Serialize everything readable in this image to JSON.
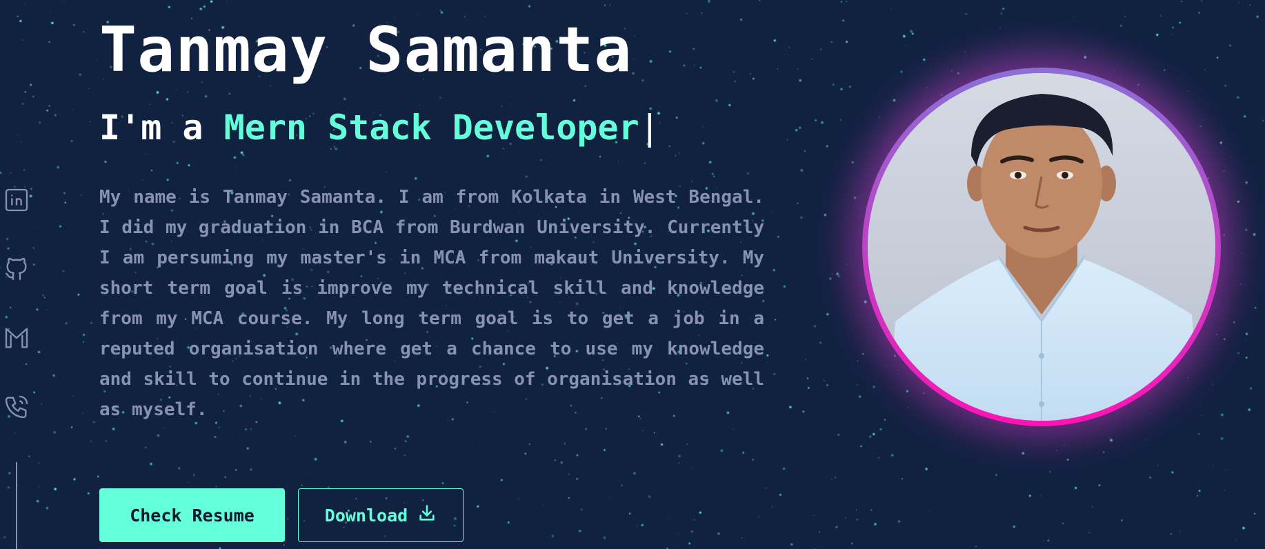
{
  "hero": {
    "name": "Tanmay Samanta",
    "tagline_prefix": "I'm a ",
    "tagline_role": "Mern Stack Developer",
    "tagline_cursor": "|",
    "bio": "My name is Tanmay Samanta. I am from Kolkata in West Bengal. I did my graduation in BCA from Burdwan University. Currently I am persuming my master's in MCA from makaut University. My short term goal is improve my technical skill and knowledge from my MCA course. My long term goal is to get a job in a reputed organisation where get a chance to use my knowledge and skill to continue in the progress of organisation as well as myself."
  },
  "buttons": {
    "resume_label": "Check Resume",
    "download_label": "Download"
  },
  "social": {
    "icons": [
      "linkedin-icon",
      "github-icon",
      "gmail-icon",
      "phone-icon"
    ]
  },
  "colors": {
    "background": "#112240",
    "accent": "#64ffda",
    "text_muted": "#8892b0",
    "heading": "#ffffff",
    "photo_glow": "#ff13b5"
  }
}
